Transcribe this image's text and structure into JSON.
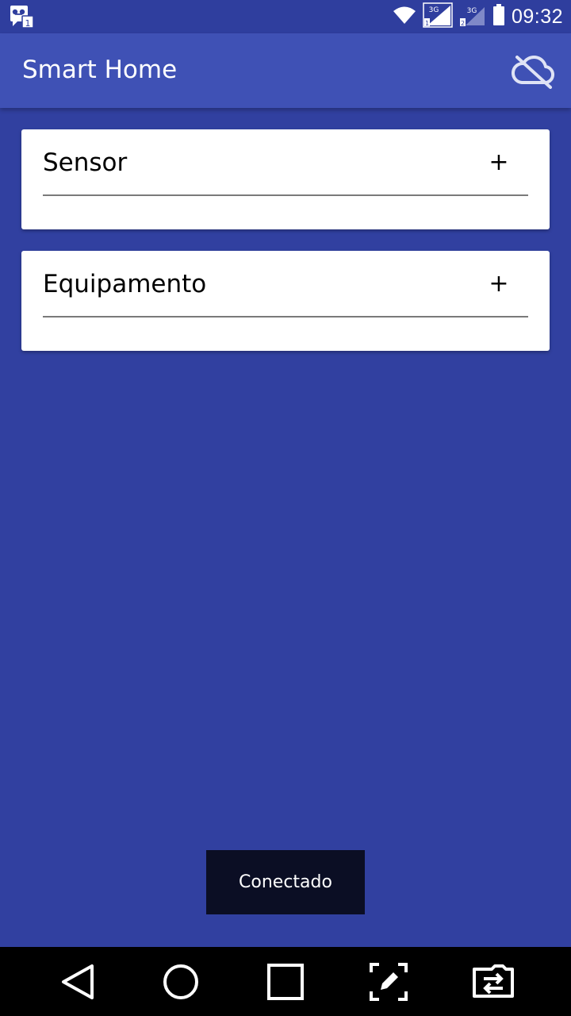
{
  "status_bar": {
    "time": "09:32",
    "network_1": "3G",
    "network_2": "3G"
  },
  "app_bar": {
    "title": "Smart Home",
    "cloud_icon": "cloud-off-icon"
  },
  "cards": [
    {
      "title": "Sensor",
      "action": "+"
    },
    {
      "title": "Equipamento",
      "action": "+"
    }
  ],
  "toast": {
    "message": "Conectado"
  },
  "nav_bar": {
    "buttons": [
      "back-icon",
      "home-icon",
      "recents-icon",
      "edit-screenshot-icon",
      "switch-icon"
    ]
  },
  "colors": {
    "background": "#3140a0",
    "app_bar": "#3f51b5",
    "status_bar": "#2f3e9e",
    "card": "#ffffff",
    "toast": "#0b0e24"
  }
}
